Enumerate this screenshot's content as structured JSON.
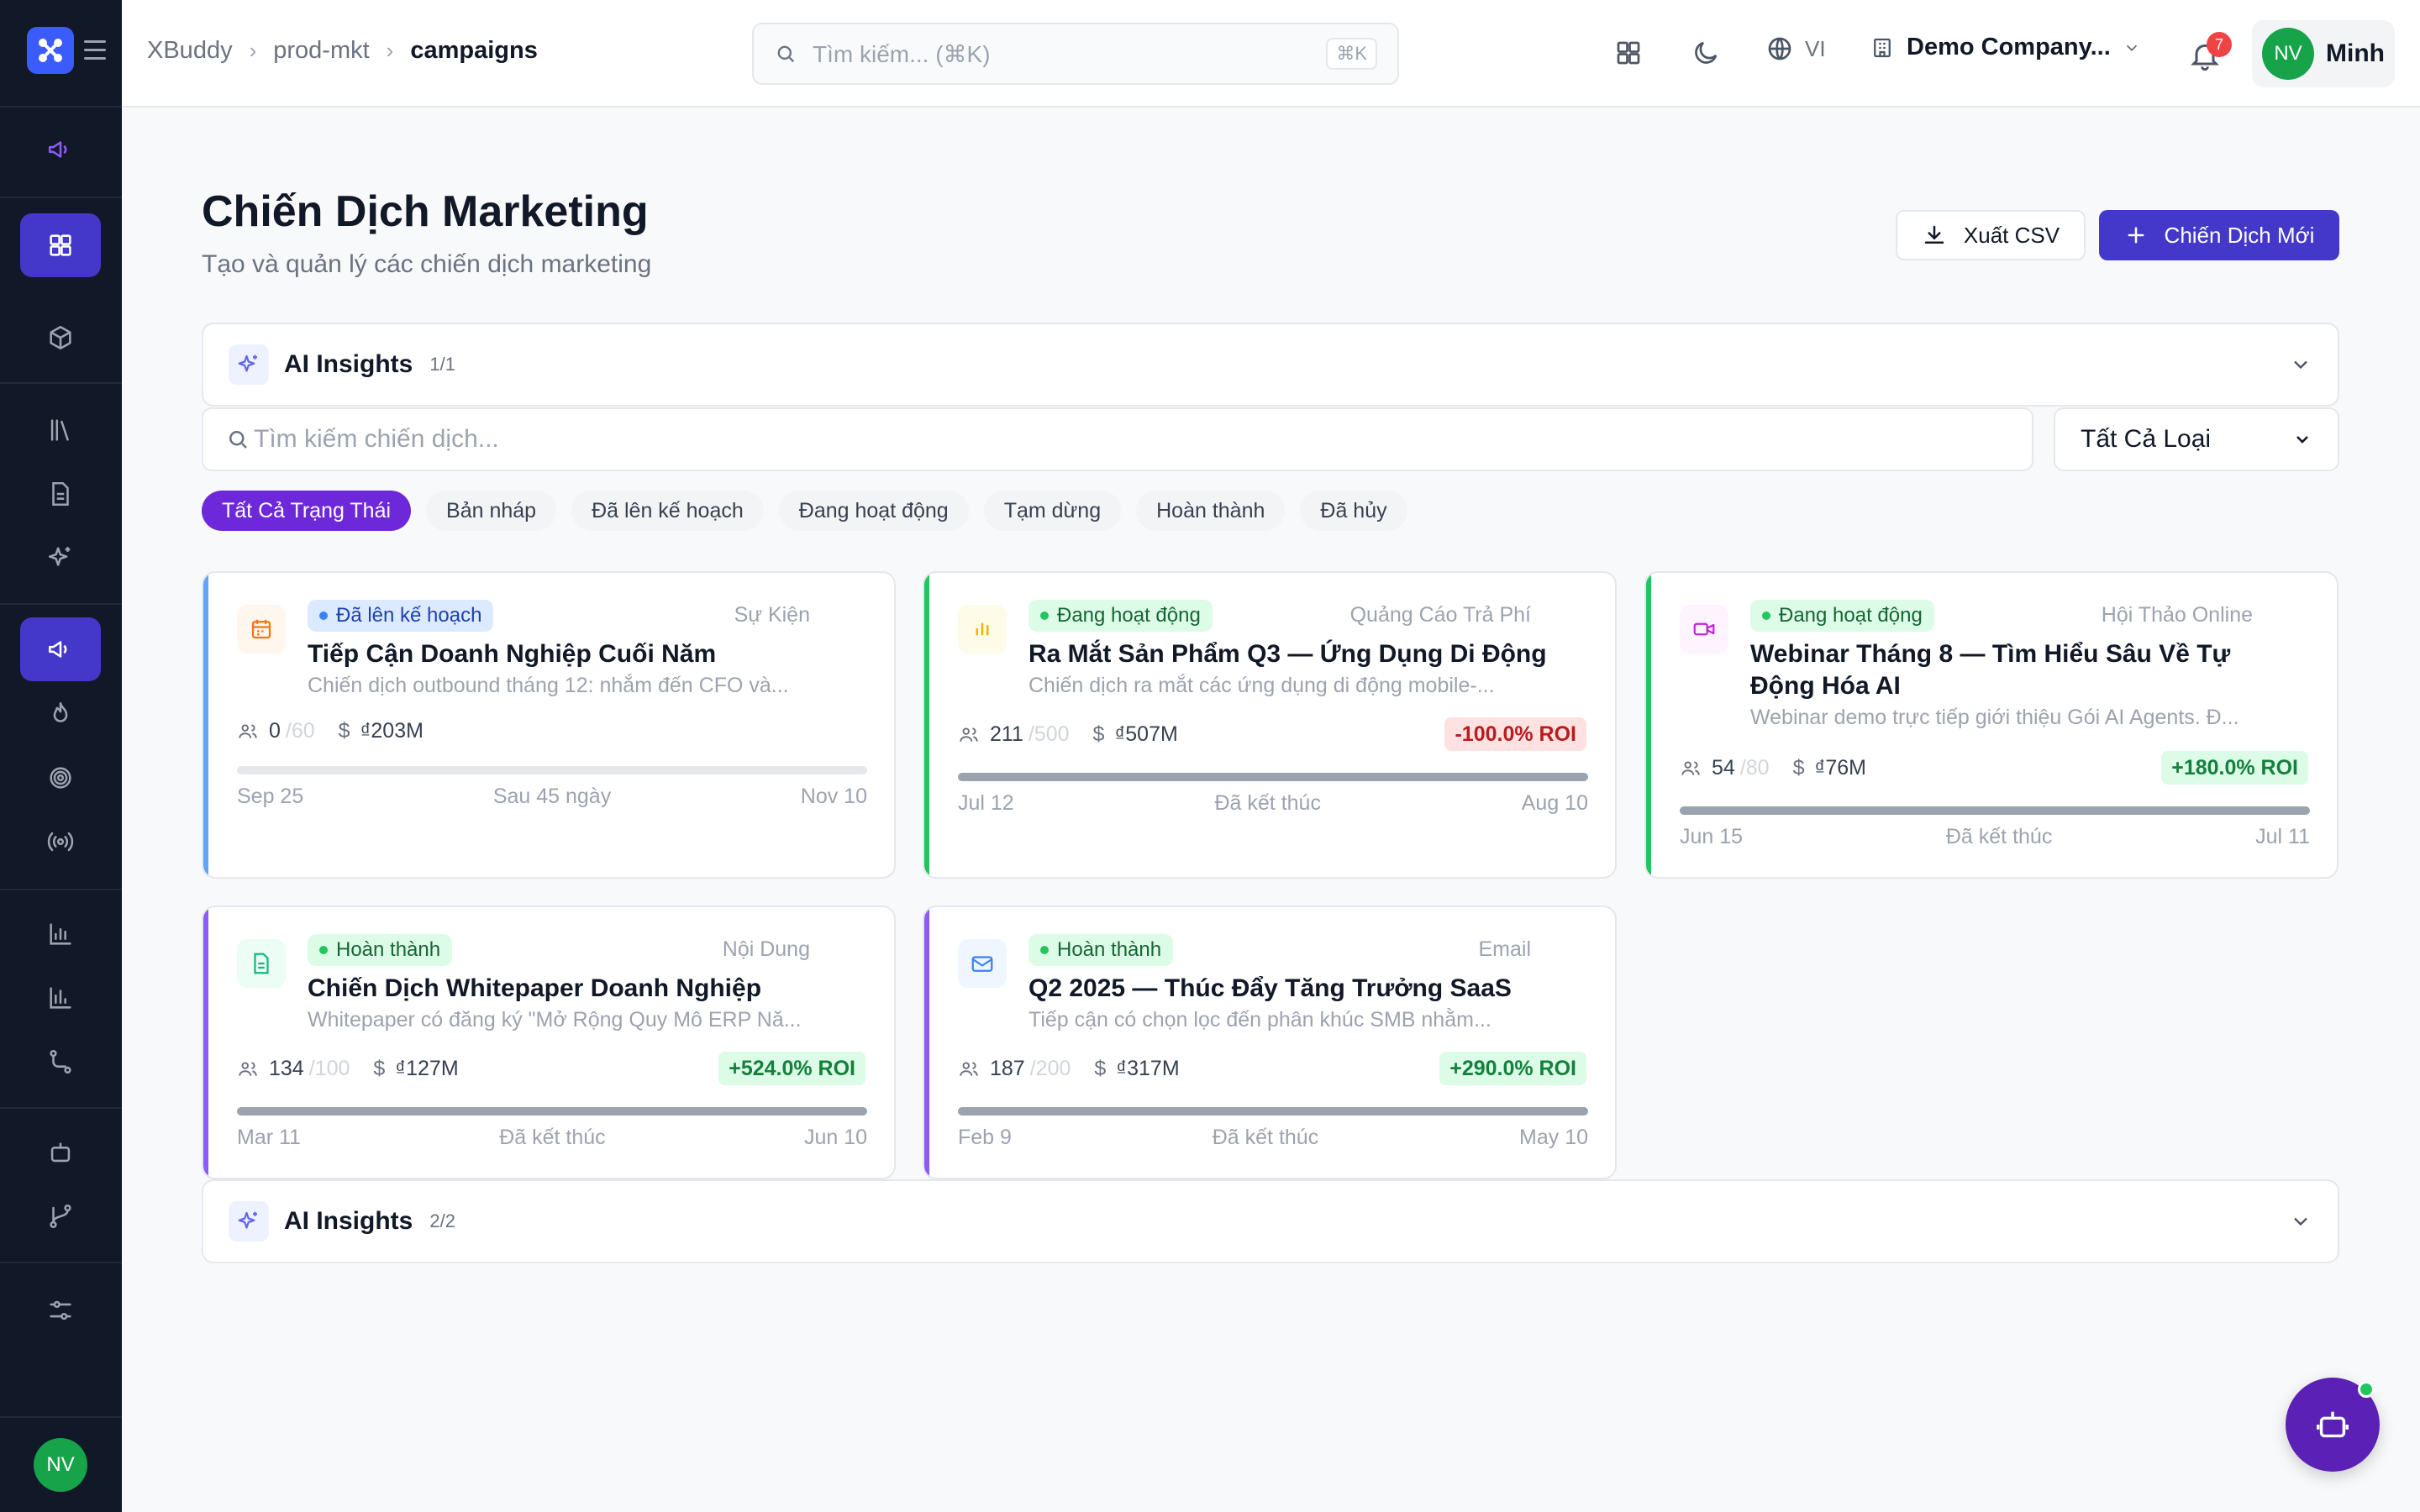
{
  "sidebar": {
    "logo_icon": "xbuddy-logo-icon",
    "avatar_initials": "NV",
    "active_color": "#4338ca"
  },
  "topbar": {
    "breadcrumb": [
      "XBuddy",
      "prod-mkt",
      "campaigns"
    ],
    "search_placeholder": "Tìm kiếm... (⌘K)",
    "search_shortcut": "⌘K",
    "language": "VI",
    "company": "Demo Company...",
    "notifications_count": "7",
    "user_initials": "NV",
    "user_name": "Minh"
  },
  "page": {
    "title": "Chiến Dịch Marketing",
    "subtitle": "Tạo và quản lý các chiến dịch marketing",
    "export_label": "Xuất CSV",
    "new_label": "Chiến Dịch Mới",
    "accent_color": "#4338ca"
  },
  "insights_top": {
    "label": "AI Insights",
    "count": "1/1"
  },
  "insights_bottom": {
    "label": "AI Insights",
    "count": "2/2"
  },
  "filters": {
    "search_placeholder": "Tìm kiếm chiến dịch...",
    "type_select": "Tất Cả Loại",
    "status_chips": [
      "Tất Cả Trạng Thái",
      "Bản nháp",
      "Đã lên kế hoạch",
      "Đang hoạt động",
      "Tạm dừng",
      "Hoàn thành",
      "Đã hủy"
    ],
    "active_chip": "Tất Cả Trạng Thái"
  },
  "campaigns": [
    {
      "status": "Đã lên kế hoạch",
      "type": "Sự Kiện",
      "title": "Tiếp Cận Doanh Nghiệp Cuối Năm",
      "desc": "Chiến dịch outbound tháng 12: nhắm đến CFO và...",
      "participants": "0",
      "target": "/60",
      "budget": "₫203M",
      "roi": "",
      "start": "Sep 25",
      "mid": "Sau 45 ngày",
      "end": "Nov 10",
      "progress": 0,
      "color": "#3b82f6",
      "icon": "calendar-icon"
    },
    {
      "status": "Đang hoạt động",
      "type": "Quảng Cáo Trả Phí",
      "title": "Ra Mắt Sản Phẩm Q3 — Ứng Dụng Di Động",
      "desc": "Chiến dịch ra mắt các ứng dụng di động mobile-...",
      "participants": "211",
      "target": "/500",
      "budget": "₫507M",
      "roi": "-100.0% ROI",
      "start": "Jul 12",
      "mid": "Đã kết thúc",
      "end": "Aug 10",
      "progress": 1,
      "color": "#22c55e",
      "icon": "bar-chart-icon"
    },
    {
      "status": "Đang hoạt động",
      "type": "Hội Thảo Online",
      "title": "Webinar Tháng 8 — Tìm Hiểu Sâu Về Tự Động Hóa AI",
      "desc": "Webinar demo trực tiếp giới thiệu Gói AI Agents. Đ...",
      "participants": "54",
      "target": "/80",
      "budget": "₫76M",
      "roi": "+180.0% ROI",
      "start": "Jun 15",
      "mid": "Đã kết thúc",
      "end": "Jul 11",
      "progress": 1,
      "color": "#22c55e",
      "icon": "video-icon"
    },
    {
      "status": "Hoàn thành",
      "type": "Nội Dung",
      "title": "Chiến Dịch Whitepaper Doanh Nghiệp",
      "desc": "Whitepaper có đăng ký \"Mở Rộng Quy Mô ERP Nă...",
      "participants": "134",
      "target": "/100",
      "budget": "₫127M",
      "roi": "+524.0% ROI",
      "start": "Mar 11",
      "mid": "Đã kết thúc",
      "end": "Jun 10",
      "progress": 1,
      "color": "#8b5cf6",
      "icon": "document-icon"
    },
    {
      "status": "Hoàn thành",
      "type": "Email",
      "title": "Q2 2025 — Thúc Đẩy Tăng Trưởng SaaS",
      "desc": "Tiếp cận có chọn lọc đến phân khúc SMB nhằm...",
      "participants": "187",
      "target": "/200",
      "budget": "₫317M",
      "roi": "+290.0% ROI",
      "start": "Feb 9",
      "mid": "Đã kết thúc",
      "end": "May 10",
      "progress": 1,
      "color": "#8b5cf6",
      "icon": "mail-icon"
    }
  ]
}
